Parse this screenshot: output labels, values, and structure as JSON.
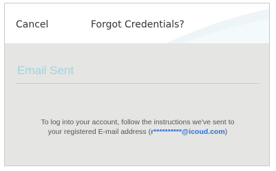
{
  "header": {
    "cancel_label": "Cancel",
    "title": "Forgot Credentials?"
  },
  "main": {
    "status_label": "Email Sent",
    "message_line1": "To log into your account, follow the instructions we've sent to",
    "message_line2_prefix": "your registered E-mail address (",
    "masked_email": "r**********@icoud.com",
    "message_line2_suffix": ")"
  },
  "colors": {
    "accent": "#9fd3e0",
    "link": "#2a6fd6",
    "background": "#e5e5e3"
  }
}
